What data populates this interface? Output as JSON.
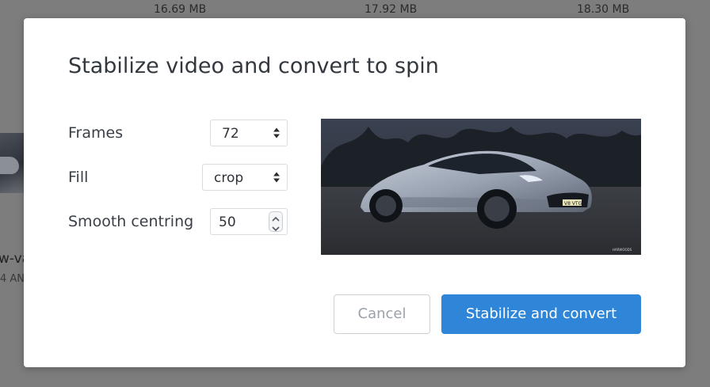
{
  "background": {
    "file_sizes": [
      "16.69 MB",
      "17.92 MB",
      "18.30 MB"
    ],
    "file_name_fragment": "w-va",
    "file_time_fragment": "4 AN"
  },
  "dialog": {
    "title": "Stabilize video and convert to spin",
    "frames": {
      "label": "Frames",
      "value": "72"
    },
    "fill": {
      "label": "Fill",
      "value": "crop"
    },
    "smooth": {
      "label": "Smooth centring",
      "value": "50"
    },
    "preview_watermark": "HARWOODS",
    "preview_plate": "V8 VTG",
    "cancel_label": "Cancel",
    "confirm_label": "Stabilize and convert"
  },
  "colors": {
    "primary": "#2f86d8",
    "overlay": "#7d7d7d",
    "text": "#33383f"
  },
  "icons": {
    "select_arrows": "up-down-caret-icon",
    "stepper": "spin-stepper-icon"
  }
}
